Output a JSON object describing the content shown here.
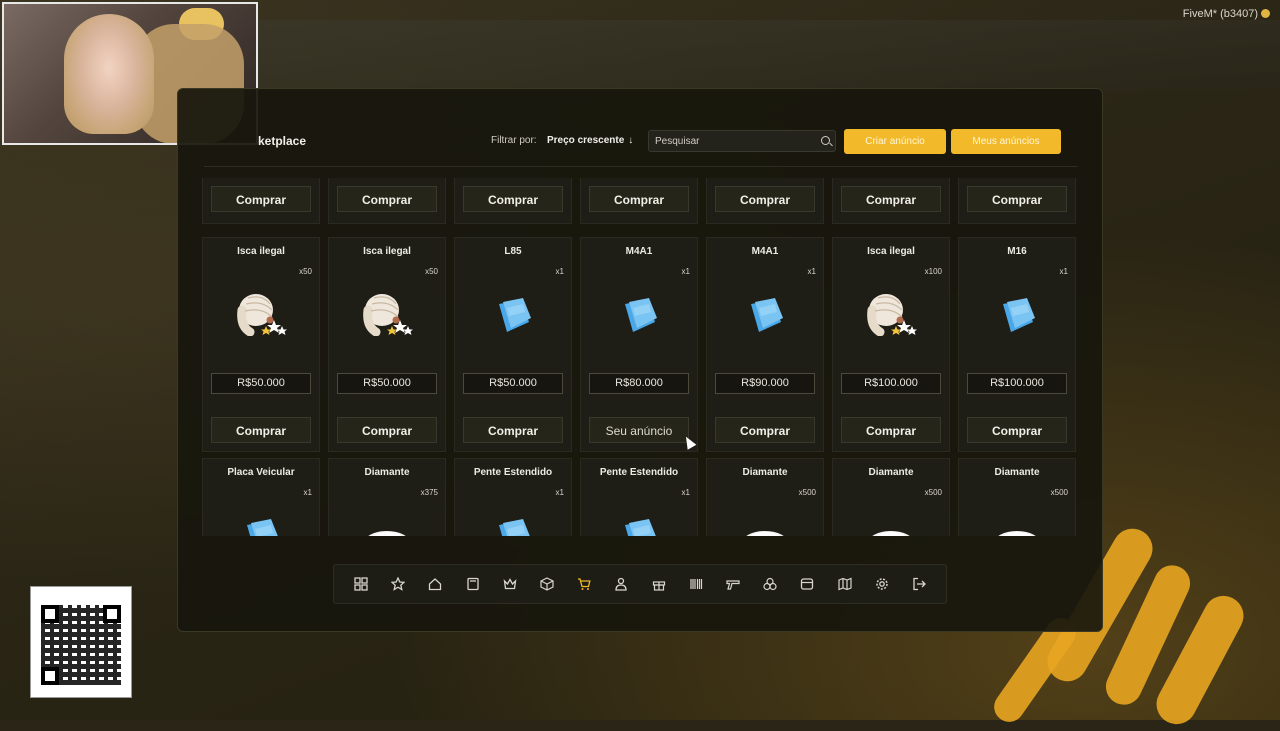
{
  "overlay": {
    "fivem_label": "FiveM* (b3407)"
  },
  "header": {
    "title": "ketplace",
    "filter_label": "Filtrar por:",
    "filter_value": "Preço crescente",
    "search_placeholder": "Pesquisar",
    "create_button": "Criar anúncio",
    "my_ads_button": "Meus anúncios"
  },
  "colors": {
    "accent": "#f2b92a",
    "panel_bg": "#18170d",
    "card_bg": "#1e1d16"
  },
  "row_top": {
    "buttons": [
      "Comprar",
      "Comprar",
      "Comprar",
      "Comprar",
      "Comprar",
      "Comprar",
      "Comprar"
    ]
  },
  "row_middle": [
    {
      "name": "Isca ilegal",
      "qty": "x50",
      "icon": "larva-icon",
      "price": "R$50.000",
      "button": "Comprar"
    },
    {
      "name": "Isca ilegal",
      "qty": "x50",
      "icon": "larva-icon",
      "price": "R$50.000",
      "button": "Comprar"
    },
    {
      "name": "L85",
      "qty": "x1",
      "icon": "weapon-paper-icon",
      "price": "R$50.000",
      "button": "Comprar"
    },
    {
      "name": "M4A1",
      "qty": "x1",
      "icon": "weapon-paper-icon",
      "price": "R$80.000",
      "button": "Seu anúncio"
    },
    {
      "name": "M4A1",
      "qty": "x1",
      "icon": "weapon-paper-icon",
      "price": "R$90.000",
      "button": "Comprar"
    },
    {
      "name": "Isca ilegal",
      "qty": "x100",
      "icon": "larva-icon",
      "price": "R$100.000",
      "button": "Comprar"
    },
    {
      "name": "M16",
      "qty": "x1",
      "icon": "weapon-paper-icon",
      "price": "R$100.000",
      "button": "Comprar"
    }
  ],
  "row_bottom": [
    {
      "name": "Placa Veicular",
      "qty": "x1",
      "icon": "blue-item-icon"
    },
    {
      "name": "Diamante",
      "qty": "x375",
      "icon": "diamond-icon"
    },
    {
      "name": "Pente Estendido",
      "qty": "x1",
      "icon": "blue-item-icon"
    },
    {
      "name": "Pente Estendido",
      "qty": "x1",
      "icon": "blue-item-icon"
    },
    {
      "name": "Diamante",
      "qty": "x500",
      "icon": "diamond-icon"
    },
    {
      "name": "Diamante",
      "qty": "x500",
      "icon": "diamond-icon"
    },
    {
      "name": "Diamante",
      "qty": "x500",
      "icon": "diamond-icon"
    }
  ],
  "bottom_nav": {
    "icons": [
      "grid-icon",
      "star-icon",
      "home-icon",
      "save-icon",
      "crown-icon",
      "box-icon",
      "cart-icon",
      "user-icon",
      "gift-icon",
      "barcode-icon",
      "weapon-icon",
      "recycle-icon",
      "storage-icon",
      "map-icon",
      "gear-icon",
      "logout-icon"
    ],
    "active": "cart-icon"
  }
}
